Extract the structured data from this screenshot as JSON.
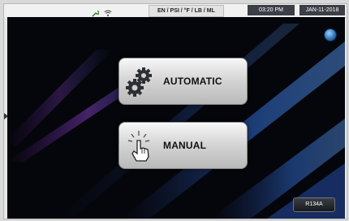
{
  "header": {
    "units": "EN / PSI / °F / LB / ML",
    "time": "03:20 PM",
    "date": "JAN-11-2018"
  },
  "main": {
    "automatic_label": "AUTOMATIC",
    "manual_label": "MANUAL",
    "refrigerant_label": "R134A"
  },
  "colors": {
    "screen_bg": "#05060b",
    "accent_purple": "#7b3bb5",
    "accent_blue": "#2f6bd1"
  },
  "icons": [
    "wrench-icon",
    "wifi-icon",
    "settings-icon",
    "gears-icon",
    "hand-pointer-icon",
    "chevron-right-icon"
  ]
}
